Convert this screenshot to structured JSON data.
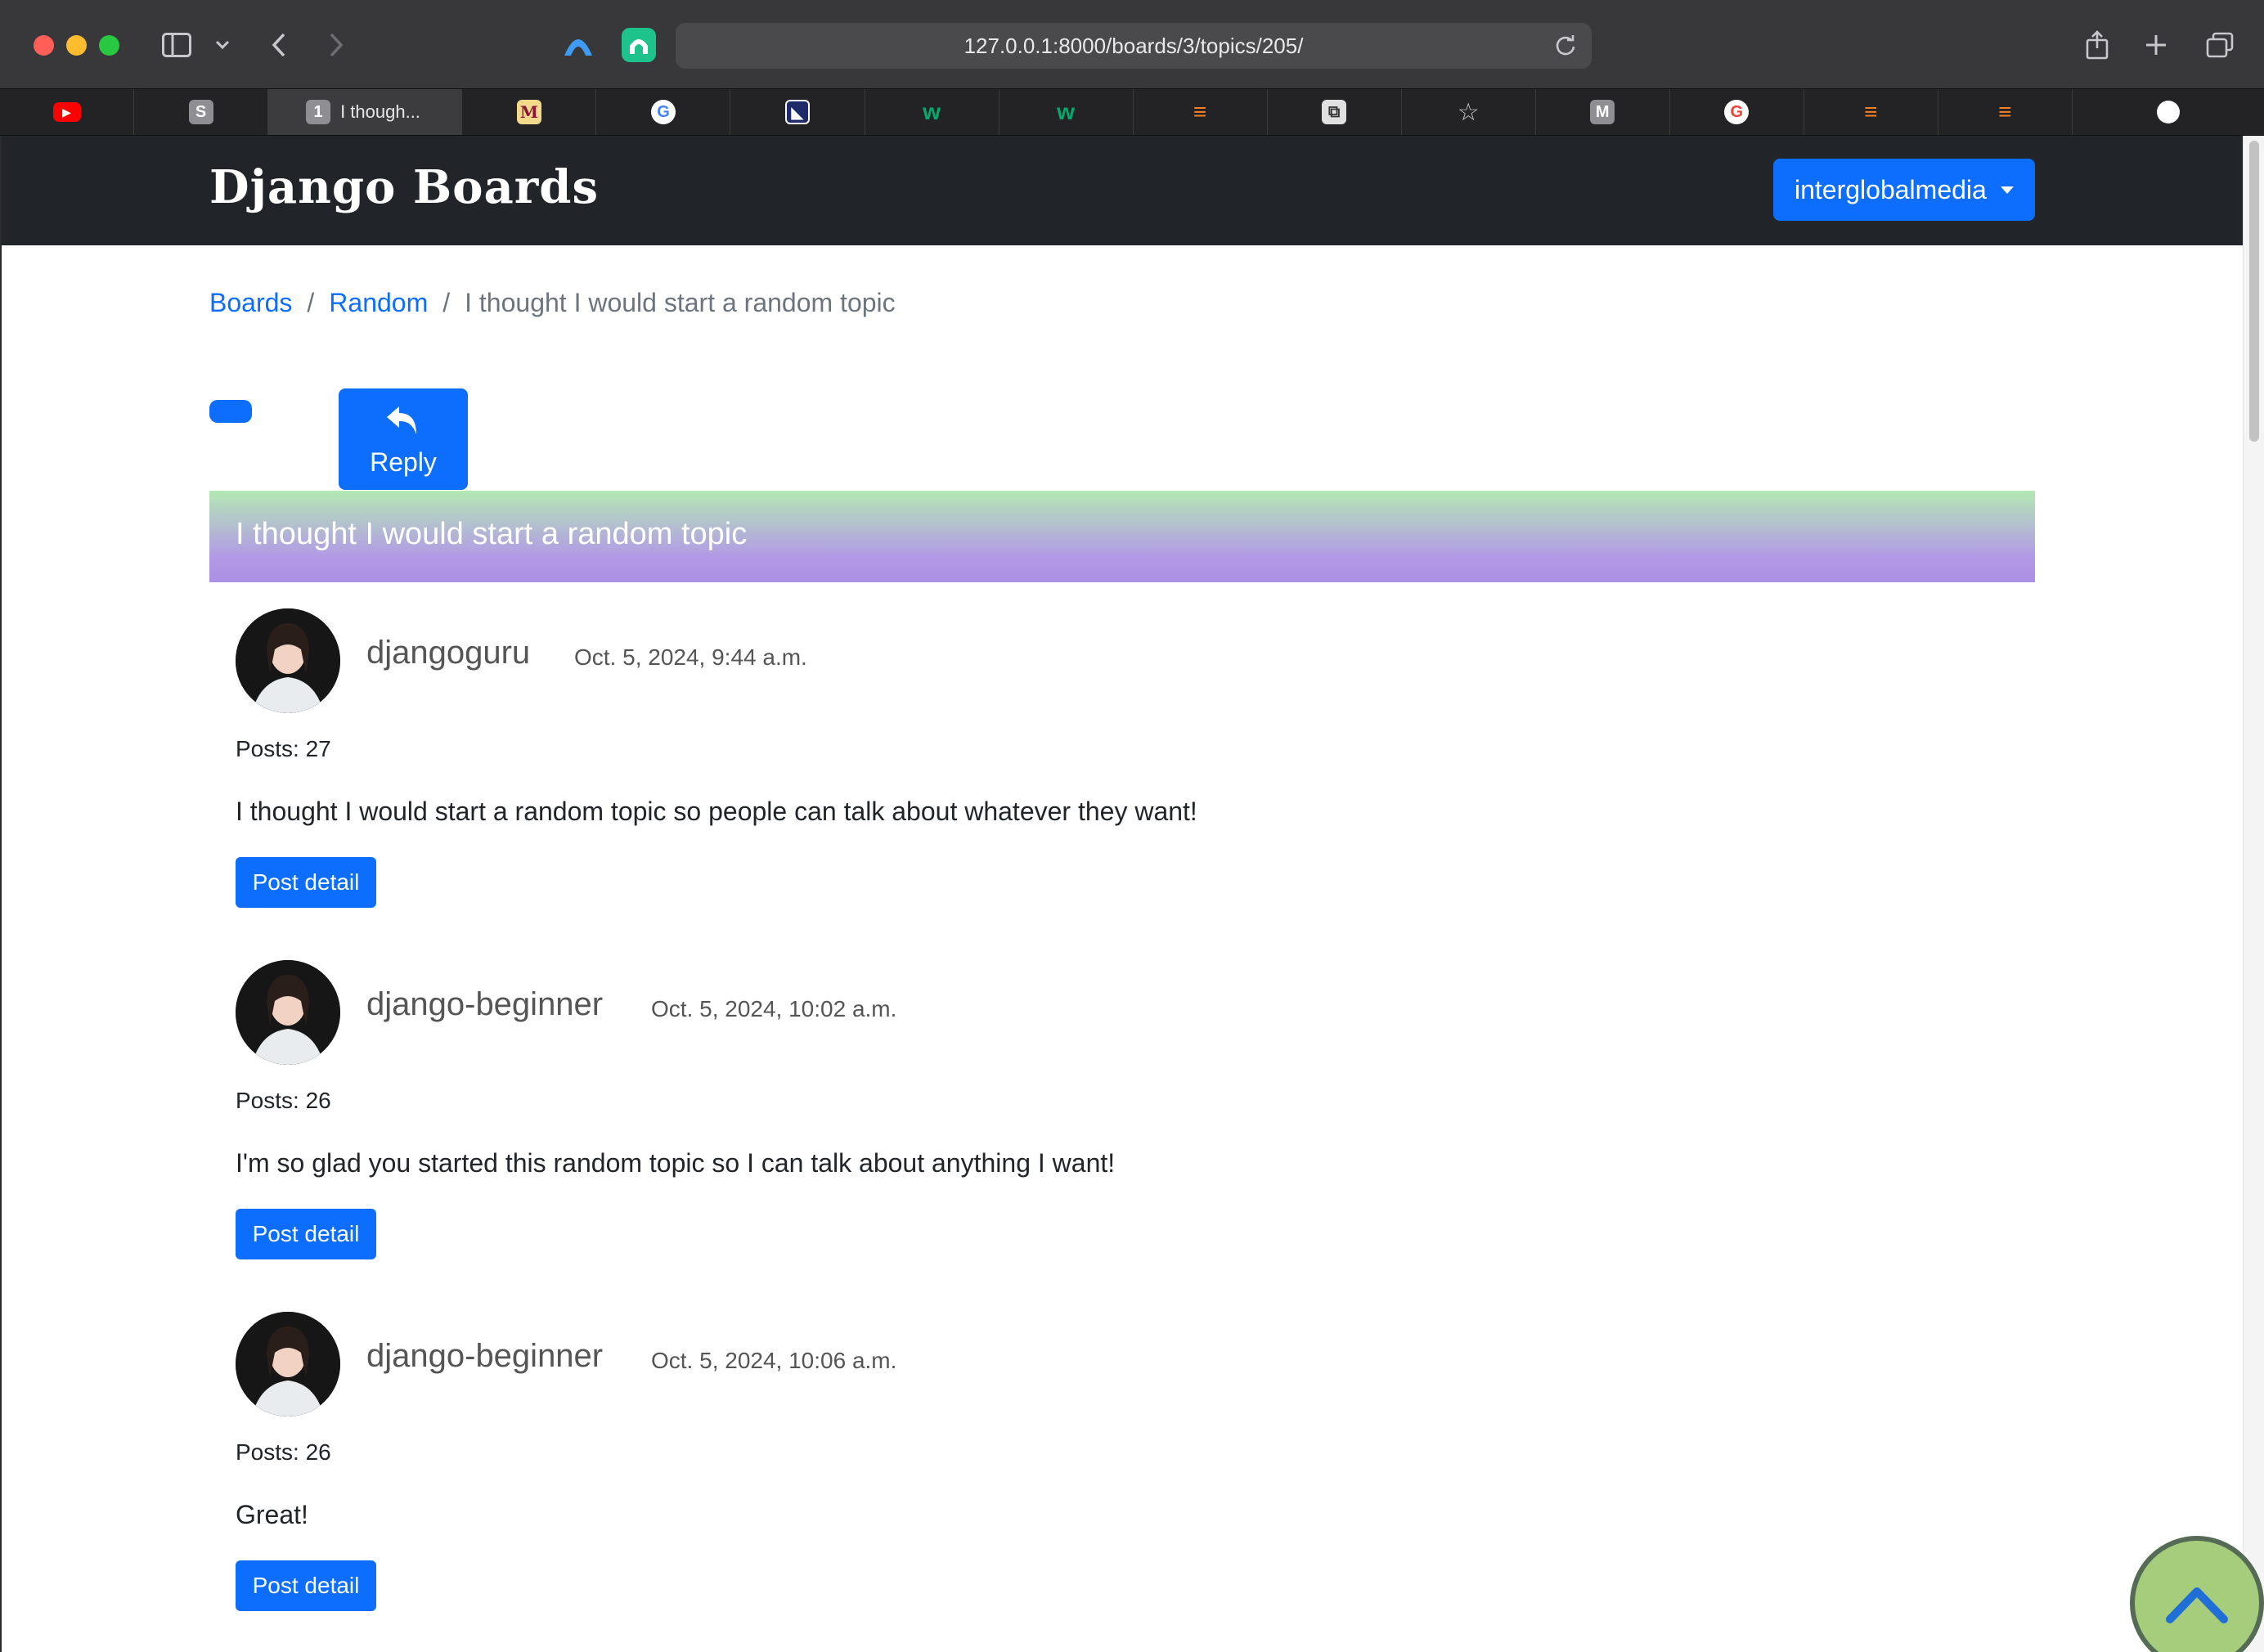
{
  "browser": {
    "url": "127.0.0.1:8000/boards/3/topics/205/",
    "active_tab_label": "I though...",
    "active_tab_badge": "1",
    "tabs": [
      {
        "icon": "youtube-icon",
        "letter": "▶",
        "color": "#ff0000"
      },
      {
        "icon": "s-site-icon",
        "letter": "S",
        "color": "#8e8e93"
      },
      {
        "icon": "active",
        "letter": "1",
        "color": "#8e8e93"
      },
      {
        "icon": "m-site-icon",
        "letter": "M",
        "color": "#f2c94c"
      },
      {
        "icon": "google-icon",
        "letter": "G",
        "color": "#ffffff"
      },
      {
        "icon": "app-icon",
        "letter": "◣",
        "color": "#1f2a6b"
      },
      {
        "icon": "w3-icon",
        "letter": "w",
        "color": "#04aa6d"
      },
      {
        "icon": "w3-icon",
        "letter": "w",
        "color": "#04aa6d"
      },
      {
        "icon": "stackoverflow-icon",
        "letter": "≡",
        "color": "#f48024"
      },
      {
        "icon": "squarespace-icon",
        "letter": "⧉",
        "color": "#e0e0e0"
      },
      {
        "icon": "star-icon",
        "letter": "☆",
        "color": "#c8c8cc"
      },
      {
        "icon": "m-site-icon",
        "letter": "M",
        "color": "#8e8e93"
      },
      {
        "icon": "google-icon",
        "letter": "G",
        "color": "#ffffff"
      },
      {
        "icon": "stackoverflow-icon",
        "letter": "≡",
        "color": "#f48024"
      },
      {
        "icon": "stackoverflow-icon",
        "letter": "≡",
        "color": "#f48024"
      },
      {
        "icon": "github-icon",
        "letter": "●",
        "color": "#ffffff"
      }
    ]
  },
  "site": {
    "brand": "Django Boards",
    "user_menu": "interglobalmedia"
  },
  "breadcrumb": {
    "boards": "Boards",
    "random": "Random",
    "current": "I thought I would start a random topic",
    "separator": "/"
  },
  "topic": {
    "reply_label": "Reply",
    "title": "I thought I would start a random topic"
  },
  "posts": [
    {
      "username": "djangoguru",
      "date": "Oct. 5, 2024, 9:44 a.m.",
      "posts_count": "Posts: 27",
      "message": "I thought I would start a random topic so people can talk about whatever they want!",
      "detail_label": "Post detail"
    },
    {
      "username": "django-beginner",
      "date": "Oct. 5, 2024, 10:02 a.m.",
      "posts_count": "Posts: 26",
      "message": "I'm so glad you started this random topic so I can talk about anything I want!",
      "detail_label": "Post detail"
    },
    {
      "username": "django-beginner",
      "date": "Oct. 5, 2024, 10:06 a.m.",
      "posts_count": "Posts: 26",
      "message": "Great!",
      "detail_label": "Post detail"
    }
  ],
  "colors": {
    "primary": "#0d6efd",
    "navbar": "#212529",
    "banner_top": "#b3e8b3",
    "banner_bottom": "#ab8fe3",
    "scroll_top_button": "#a5cd7c"
  }
}
